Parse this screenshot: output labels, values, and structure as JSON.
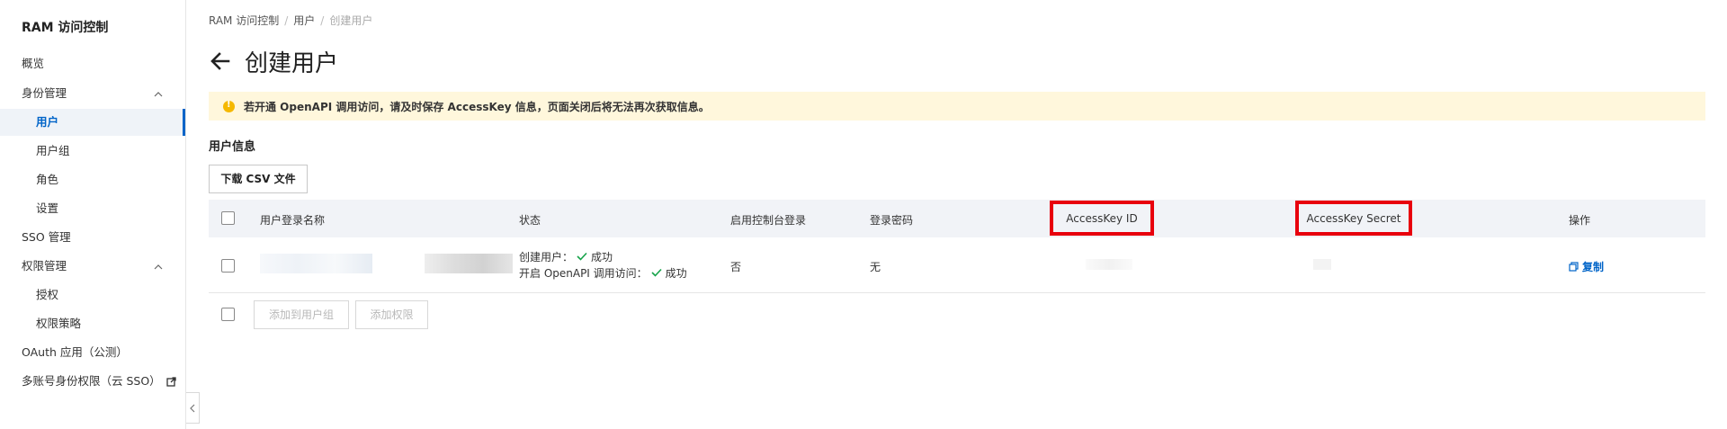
{
  "sidebar": {
    "title": "RAM 访问控制",
    "items": [
      {
        "label": "概览"
      },
      {
        "label": "身份管理"
      },
      {
        "label": "用户"
      },
      {
        "label": "用户组"
      },
      {
        "label": "角色"
      },
      {
        "label": "设置"
      },
      {
        "label": "SSO 管理"
      },
      {
        "label": "权限管理"
      },
      {
        "label": "授权"
      },
      {
        "label": "权限策略"
      },
      {
        "label": "OAuth 应用（公测）"
      },
      {
        "label": "多账号身份权限（云 SSO）"
      }
    ]
  },
  "breadcrumb": [
    "RAM 访问控制",
    "用户",
    "创建用户"
  ],
  "page": {
    "title": "创建用户"
  },
  "alert": {
    "message": "若开通 OpenAPI 调用访问，请及时保存 AccessKey 信息，页面关闭后将无法再次获取信息。"
  },
  "section": {
    "title": "用户信息"
  },
  "actions": {
    "download_csv": "下载 CSV 文件",
    "add_to_group": "添加到用户组",
    "add_permission": "添加权限"
  },
  "table": {
    "headers": {
      "login_name": "用户登录名称",
      "status": "状态",
      "console_login": "启用控制台登录",
      "password": "登录密码",
      "ak_id": "AccessKey ID",
      "ak_secret": "AccessKey Secret",
      "operation": "操作"
    },
    "rows": [
      {
        "status_line1_label": "创建用户：",
        "status_line1_value": "成功",
        "status_line2_label": "开启 OpenAPI 调用访问：",
        "status_line2_value": "成功",
        "console_login": "否",
        "password": "无",
        "operation": "复制"
      }
    ]
  },
  "colors": {
    "accent": "#0064c8",
    "highlight": "#e8000d",
    "alert_bg": "#fff7dc",
    "success": "#16a34a"
  }
}
